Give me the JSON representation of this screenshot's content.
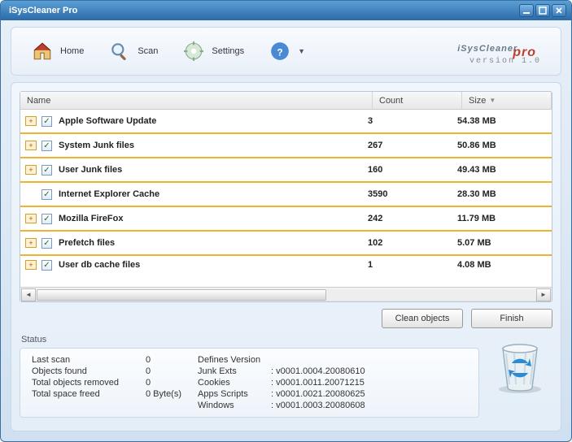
{
  "window": {
    "title": "iSysCleaner Pro"
  },
  "toolbar": {
    "home": "Home",
    "scan": "Scan",
    "settings": "Settings"
  },
  "brand": {
    "name": "iSysCleaner",
    "suffix": "pro",
    "version": "version 1.0"
  },
  "grid": {
    "headers": {
      "name": "Name",
      "count": "Count",
      "size": "Size"
    },
    "rows": [
      {
        "name": "Apple Software Update",
        "count": "3",
        "size": "54.38 MB",
        "indent": false
      },
      {
        "name": "System Junk files",
        "count": "267",
        "size": "50.86 MB",
        "indent": false
      },
      {
        "name": "User Junk files",
        "count": "160",
        "size": "49.43 MB",
        "indent": false
      },
      {
        "name": "Internet Explorer Cache",
        "count": "3590",
        "size": "28.30 MB",
        "indent": true
      },
      {
        "name": "Mozilla FireFox",
        "count": "242",
        "size": "11.79 MB",
        "indent": false
      },
      {
        "name": "Prefetch files",
        "count": "102",
        "size": "5.07 MB",
        "indent": false
      },
      {
        "name": "User db cache files",
        "count": "1",
        "size": "4.08 MB",
        "indent": false
      }
    ]
  },
  "buttons": {
    "clean": "Clean objects",
    "finish": "Finish"
  },
  "status": {
    "label": "Status",
    "left": [
      {
        "k": "Last scan",
        "v": "0"
      },
      {
        "k": "Objects found",
        "v": "0"
      },
      {
        "k": "Total objects removed",
        "v": "0"
      },
      {
        "k": "Total space freed",
        "v": "0 Byte(s)"
      }
    ],
    "defs_label": "Defines Version",
    "defs": [
      {
        "k": "Junk Exts",
        "v": ": v0001.0004.20080610"
      },
      {
        "k": "Cookies",
        "v": ": v0001.0011.20071215"
      },
      {
        "k": "Apps Scripts",
        "v": ": v0001.0021.20080625"
      },
      {
        "k": "Windows",
        "v": ": v0001.0003.20080608"
      }
    ]
  }
}
